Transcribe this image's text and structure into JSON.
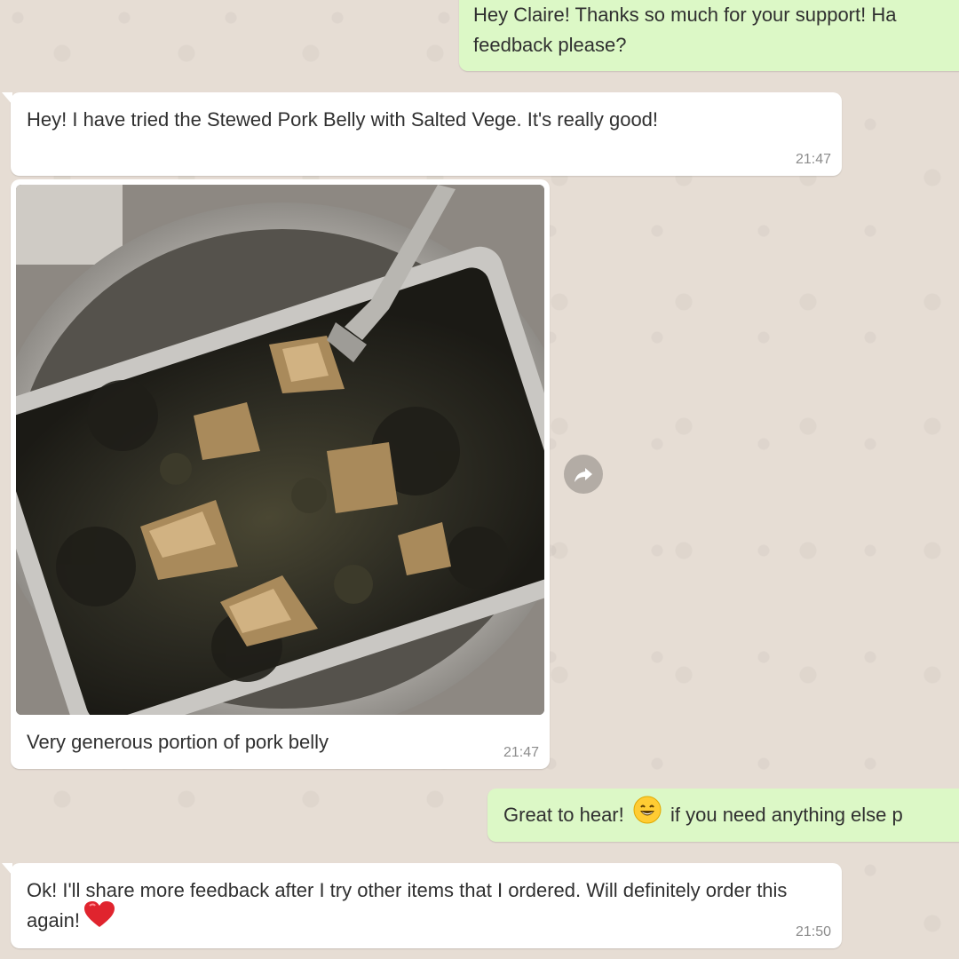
{
  "chat": {
    "messages": [
      {
        "direction": "outgoing",
        "text": "Hey Claire! Thanks so much for your support! Ha feedback please?"
      },
      {
        "direction": "incoming",
        "text": "Hey! I have tried the Stewed Pork Belly with Salted Vege. It's really good!",
        "time": "21:47"
      },
      {
        "direction": "incoming",
        "type": "image",
        "caption": "Very generous portion of pork belly",
        "time": "21:47"
      },
      {
        "direction": "outgoing",
        "text_before": "Great to hear!",
        "emoji": "grinning-smiling-eyes",
        "text_after": "if you need anything else p"
      },
      {
        "direction": "incoming",
        "text": "Ok! I'll share more feedback after I try other items that I ordered. Will definitely order this again!",
        "emoji": "red-heart",
        "time": "21:50"
      }
    ]
  },
  "icons": {
    "forward": "forward-arrow-icon"
  },
  "colors": {
    "wallpaper": "#e5ddd5",
    "incoming_bubble": "#ffffff",
    "outgoing_bubble": "#dcf8c6",
    "timestamp": "#8c8c8c"
  }
}
